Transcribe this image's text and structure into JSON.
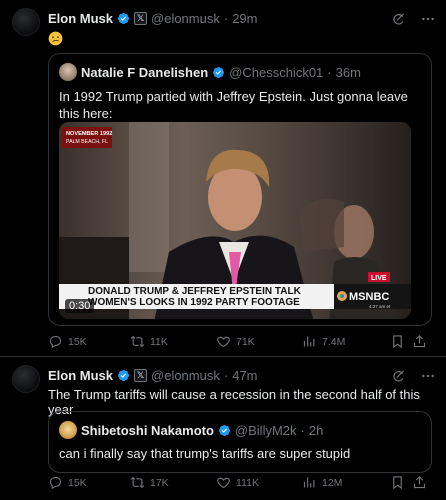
{
  "posts": [
    {
      "author": {
        "name": "Elon Musk",
        "handle": "@elonmusk",
        "time": "29m"
      },
      "text_emoji": "confused-face",
      "quote": {
        "author": {
          "name": "Natalie F Danelishen",
          "handle": "@Chesschick01",
          "time": "36m"
        },
        "text": "In 1992 Trump partied with Jeffrey Epstein. Just gonna leave this here:",
        "video": {
          "stamp_line1": "NOVEMBER 1992",
          "stamp_line2": "PALM BEACH, FL",
          "caption_line1": "DONALD TRUMP & JEFFREY EPSTEIN TALK",
          "caption_line2": "WOMEN'S LOOKS IN 1992 PARTY FOOTAGE",
          "live": "LIVE",
          "network": "MSNBC",
          "clock": "4:37 am et",
          "duration": "0:30"
        }
      },
      "stats": {
        "replies": "15K",
        "reposts": "11K",
        "likes": "71K",
        "views": "7.4M"
      }
    },
    {
      "author": {
        "name": "Elon Musk",
        "handle": "@elonmusk",
        "time": "47m"
      },
      "text": "The Trump tariffs will cause a recession in the second half of this year",
      "quote": {
        "author": {
          "name": "Shibetoshi Nakamoto",
          "handle": "@BillyM2k",
          "time": "2h"
        },
        "text": "can i finally say that trump's tariffs are super stupid"
      },
      "stats": {
        "replies": "15K",
        "reposts": "17K",
        "likes": "111K",
        "views": "12M"
      }
    }
  ],
  "colors": {
    "background": "#000000",
    "text": "#e7e9ea",
    "muted": "#71767b",
    "border": "#2f3336",
    "verified": "#1d9bf0"
  }
}
